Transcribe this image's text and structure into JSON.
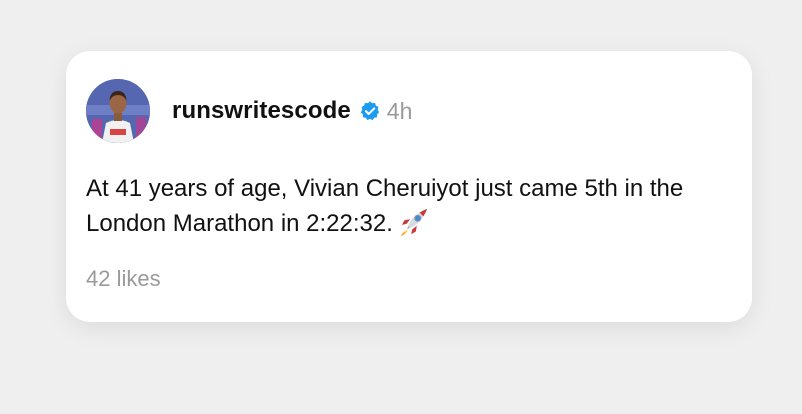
{
  "post": {
    "username": "runswritescode",
    "time": "4h",
    "text": "At 41 years of age, Vivian Cheruiyot just came 5th in the London Marathon in 2:22:32.",
    "likes": "42 likes",
    "verified": true,
    "emoji_icon": "rocket-icon"
  },
  "colors": {
    "background": "#efefef",
    "card": "#ffffff",
    "verified_badge": "#1d9bf0",
    "muted_text": "#9a9a9a"
  }
}
